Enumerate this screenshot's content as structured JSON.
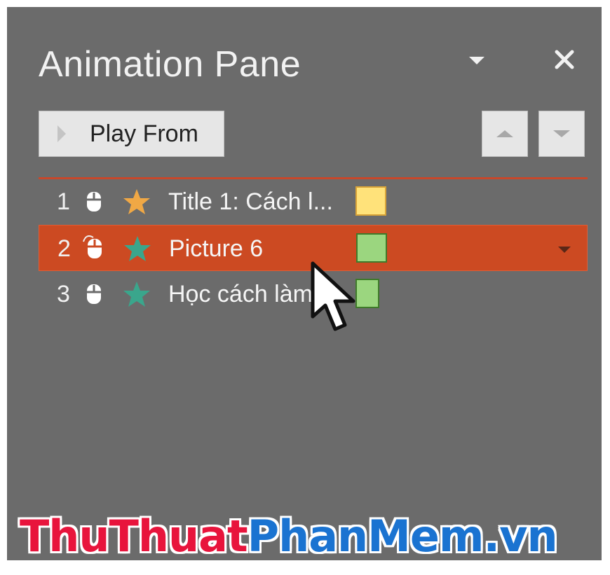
{
  "pane": {
    "title": "Animation Pane",
    "menu_icon": "chevron-down-icon",
    "close_icon": "close-icon"
  },
  "toolbar": {
    "play_label": "Play From",
    "play_icon": "play-icon",
    "move_up_icon": "arrow-up-icon",
    "move_down_icon": "arrow-down-icon"
  },
  "animations": [
    {
      "number": "1",
      "trigger_icon": "mouse-click-icon",
      "effect_icon": "star-icon",
      "effect_color": "#f0a845",
      "label": "Title 1: Cách l...",
      "timing_color": "#ffe27a",
      "timing_border": "#d8a338",
      "selected": false
    },
    {
      "number": "2",
      "trigger_icon": "mouse-click-icon",
      "effect_icon": "star-icon",
      "effect_color": "#3aa68c",
      "label": "Picture 6",
      "timing_color": "#9bd67f",
      "timing_border": "#3f7a2a",
      "selected": true
    },
    {
      "number": "3",
      "trigger_icon": "mouse-click-icon",
      "effect_icon": "star-icon",
      "effect_color": "#3aa68c",
      "label": "Học cách làm",
      "timing_color": "#9bd67f",
      "timing_border": "#3f7a2a",
      "selected": false
    }
  ],
  "colors": {
    "pane_background": "#6b6b6b",
    "selected_row": "#cc4a22",
    "divider": "#c9472a"
  },
  "watermark": {
    "part1": "ThuThuat",
    "part2": "PhanMem.vn"
  }
}
